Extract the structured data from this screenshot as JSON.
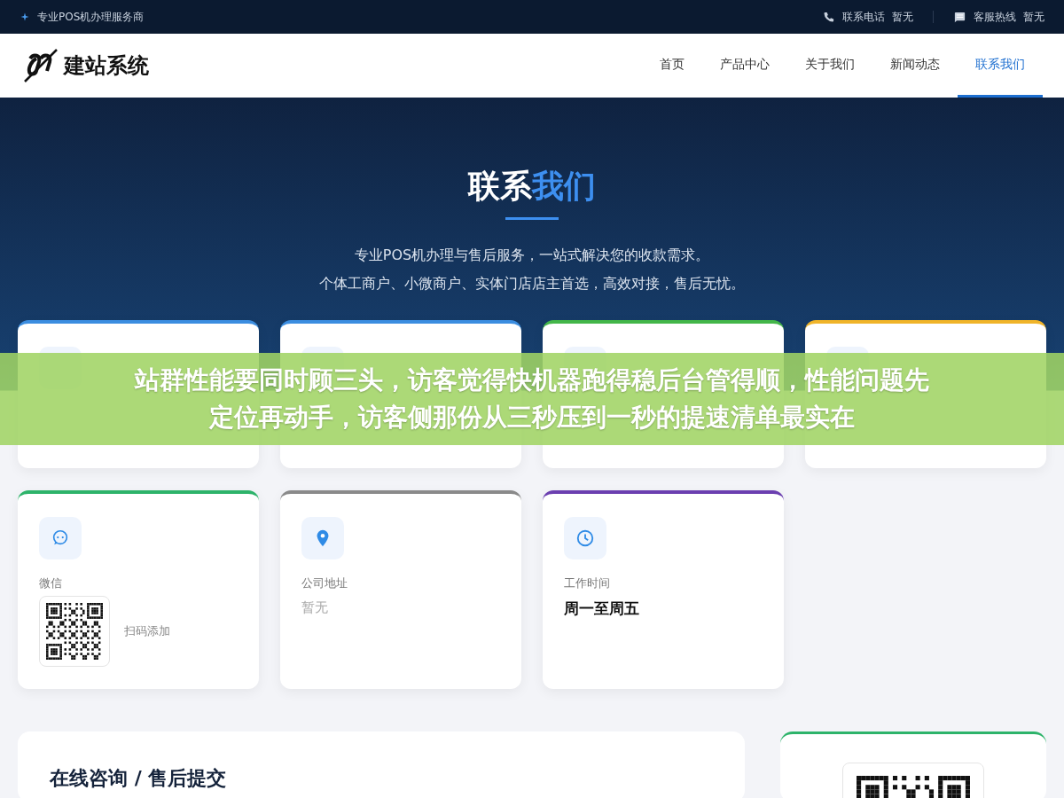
{
  "top_bar": {
    "tagline": "专业POS机办理服务商",
    "contacts": [
      {
        "kind": "phone",
        "label": "联系电话",
        "value": "暂无"
      },
      {
        "kind": "message",
        "label": "客服热线",
        "value": "暂无"
      }
    ]
  },
  "logo": {
    "text": "建站系统"
  },
  "nav": [
    {
      "label": "首页",
      "selected": false
    },
    {
      "label": "产品中心",
      "selected": false
    },
    {
      "label": "关于我们",
      "selected": false
    },
    {
      "label": "新闻动态",
      "selected": false
    },
    {
      "label": "联系我们",
      "selected": true
    }
  ],
  "hero": {
    "title": "联系",
    "title_highlight": "我们",
    "lines": [
      "专业POS机办理与售后服务，一站式解决您的收款需求。",
      "个体工商户、小微商户、实体门店店主首选，高效对接，售后无忧。"
    ]
  },
  "contact_cards": [
    {
      "color": "#3b8de0"
    },
    {
      "color": "#3b8de0"
    },
    {
      "color": "#43b649"
    },
    {
      "color": "#f0b429"
    },
    {
      "kind": "wechat",
      "color": "#2db36a",
      "label": "微信",
      "qr_caption": "扫码添加"
    },
    {
      "kind": "pin",
      "color": "#8a8a8a",
      "label": "公司地址",
      "value": "暂无",
      "emphasis": false
    },
    {
      "kind": "clock",
      "color": "#6b3fb0",
      "label": "工作时间",
      "value": "周一至周五",
      "emphasis": true
    }
  ],
  "form": {
    "title": "在线咨询 / 售后提交"
  },
  "overlay_banner": {
    "lines": [
      "站群性能要同时顾三头，访客觉得快机器跑得稳后台管得顺，性能问题先",
      "定位再动手，访客侧那份从三秒压到一秒的提速清单最实在"
    ]
  }
}
